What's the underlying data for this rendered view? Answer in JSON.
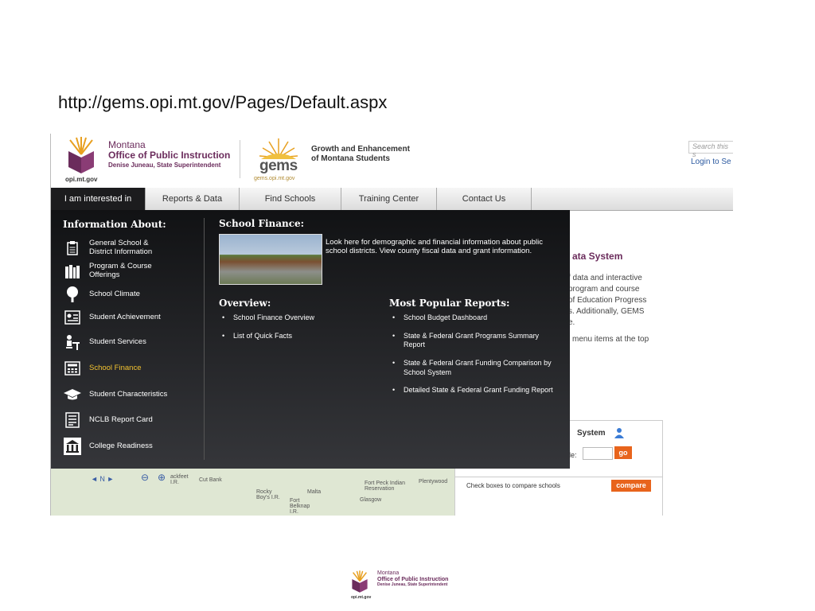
{
  "slide_title": "http://gems.opi.mt.gov/Pages/Default.aspx",
  "header": {
    "opi_line1": "Montana",
    "opi_line2": "Office of Public Instruction",
    "opi_line3": "Denise Juneau, State Superintendent",
    "opi_url": "opi.mt.gov",
    "gems_word": "gems",
    "gems_sub": "gems.opi.mt.gov",
    "gems_tag_line1": "Growth and Enhancement",
    "gems_tag_line2": "of Montana Students",
    "search_placeholder": "Search this s",
    "login": "Login to Se"
  },
  "nav": {
    "tabs": [
      "I am interested in",
      "Reports & Data",
      "Find Schools",
      "Training Center",
      "Contact Us"
    ],
    "active": 0
  },
  "menu": {
    "info_heading": "Information About:",
    "items": [
      {
        "label": "General School & District Information",
        "icon": "clipboard-icon"
      },
      {
        "label": "Program & Course Offerings",
        "icon": "books-icon"
      },
      {
        "label": "School Climate",
        "icon": "tree-icon"
      },
      {
        "label": "Student Achievement",
        "icon": "certificate-icon"
      },
      {
        "label": "Student Services",
        "icon": "student-desk-icon"
      },
      {
        "label": "School Finance",
        "icon": "calculator-icon",
        "selected": true
      },
      {
        "label": "Student Characteristics",
        "icon": "graduation-cap-icon"
      },
      {
        "label": "NCLB Report Card",
        "icon": "report-card-icon"
      },
      {
        "label": "College Readiness",
        "icon": "college-building-icon"
      }
    ],
    "finance_heading": "School Finance:",
    "finance_desc": "Look here for demographic and financial information about public school districts. View county fiscal data and grant information.",
    "overview_heading": "Overview:",
    "overview_links": [
      "School Finance Overview",
      "List of Quick Facts"
    ],
    "popular_heading": "Most Popular Reports:",
    "popular_links": [
      "School Budget Dashboard",
      "State & Federal Grant Programs Summary Report",
      "State & Federal Grant Funding Comparison by School System",
      "Detailed State & Federal Grant Funding Report"
    ]
  },
  "background": {
    "heading_fragment": "ata System",
    "para_lines": [
      "f data and interactive",
      "program and course",
      "of Education Progress",
      "s. Additionally, GEMS",
      "e."
    ],
    "menu_line": "menu items at the top"
  },
  "panel": {
    "system_title": "System",
    "code_label": "de:",
    "go_label": "go",
    "compare_text": "Check boxes to compare schools",
    "compare_label": "compare"
  },
  "map": {
    "labels": [
      "ackfeet I.R.",
      "Cut Bank",
      "Rocky Boy's I.R.",
      "Malta",
      "Fort Belknap I.R.",
      "Fort Peck Indian Reservation",
      "Glasgow",
      "Plentywood"
    ],
    "nav_label": "N"
  },
  "footer": {
    "line1": "Montana",
    "line2": "Office of Public Instruction",
    "line3": "Denise Juneau, State Superintendent",
    "url": "opi.mt.gov"
  },
  "colors": {
    "brand_purple": "#6b2c5c",
    "accent_orange": "#e8641c",
    "selected_yellow": "#f2c230",
    "menu_dark": "#1c1c1e"
  }
}
